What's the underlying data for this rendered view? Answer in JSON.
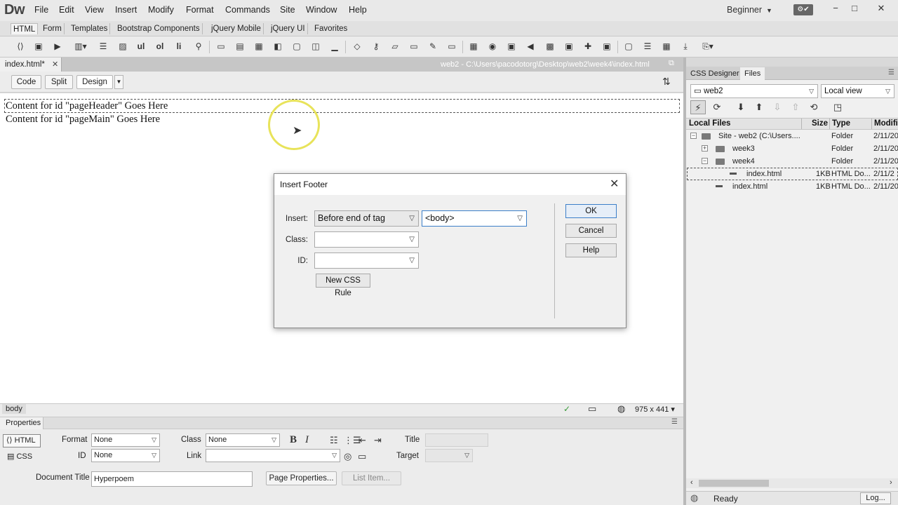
{
  "app": {
    "logo": "Dw",
    "menu": [
      "File",
      "Edit",
      "View",
      "Insert",
      "Modify",
      "Format",
      "Commands",
      "Site",
      "Window",
      "Help"
    ],
    "workspace": "Beginner",
    "window_controls": {
      "minimize": "−",
      "maximize": "□",
      "close": "✕"
    }
  },
  "insert_tabs": [
    "HTML",
    "Form",
    "Templates",
    "Bootstrap Components",
    "jQuery Mobile",
    "jQuery UI",
    "Favorites"
  ],
  "toolbar_icons": [
    "div-icon",
    "image-icon",
    "video-icon",
    "table-icon",
    "paragraph-icon",
    "figure-icon",
    "ul-icon",
    "ol-icon",
    "li-icon",
    "hyperlink-icon",
    "header-icon",
    "navigation-icon",
    "main-icon",
    "aside-icon",
    "article-icon",
    "section-icon",
    "footer-icon",
    "tag-icon",
    "key-icon",
    "comment-icon",
    "meta-icon",
    "script-icon",
    "canvas-icon",
    "table2-icon",
    "flash-icon",
    "audio-icon",
    "plugin-icon",
    "widget-icon",
    "template-icon",
    "iframe-icon",
    "hr-icon",
    "date-icon",
    "download-icon",
    "character-icon"
  ],
  "toolbar_text": {
    "ul": "ul",
    "ol": "ol",
    "li": "li"
  },
  "document": {
    "tab_label": "index.html*",
    "path": "web2 - C:\\Users\\pacodotorg\\Desktop\\web2\\week4\\index.html",
    "views": [
      "Code",
      "Split",
      "Design"
    ],
    "content": [
      "Content for id \"pageHeader\" Goes Here",
      "Content for id \"pageMain\" Goes Here"
    ]
  },
  "status_bar": {
    "tag": "body",
    "size": "975 x 441"
  },
  "properties": {
    "title": "Properties",
    "html_label": "HTML",
    "css_label": "CSS",
    "format_label": "Format",
    "format_value": "None",
    "class_label": "Class",
    "class_value": "None",
    "id_label": "ID",
    "id_value": "None",
    "link_label": "Link",
    "link_value": "",
    "title_label": "Title",
    "target_label": "Target",
    "doc_title_label": "Document Title",
    "doc_title_value": "Hyperpoem",
    "page_props_btn": "Page Properties...",
    "list_item_btn": "List Item..."
  },
  "dialog": {
    "title": "Insert Footer",
    "insert_label": "Insert:",
    "insert_value": "Before end of tag",
    "tag_value": "<body>",
    "class_label": "Class:",
    "class_value": "",
    "id_label": "ID:",
    "id_value": "",
    "new_css_rule": "New CSS Rule",
    "ok": "OK",
    "cancel": "Cancel",
    "help": "Help"
  },
  "files_panel": {
    "tabs": [
      "CSS Designer",
      "Files"
    ],
    "site": "web2",
    "view": "Local view",
    "columns": [
      "Local Files",
      "Size",
      "Type",
      "Modifi"
    ],
    "rows": [
      {
        "name": "Site - web2 (C:\\Users....",
        "size": "",
        "type": "Folder",
        "modified": "2/11/20"
      },
      {
        "name": "week3",
        "size": "",
        "type": "Folder",
        "modified": "2/11/20"
      },
      {
        "name": "week4",
        "size": "",
        "type": "Folder",
        "modified": "2/11/20"
      },
      {
        "name": "index.html",
        "size": "1KB",
        "type": "HTML Do...",
        "modified": "2/11/2"
      },
      {
        "name": "index.html",
        "size": "1KB",
        "type": "HTML Do...",
        "modified": "2/11/20"
      }
    ],
    "status": "Ready",
    "log_btn": "Log..."
  }
}
